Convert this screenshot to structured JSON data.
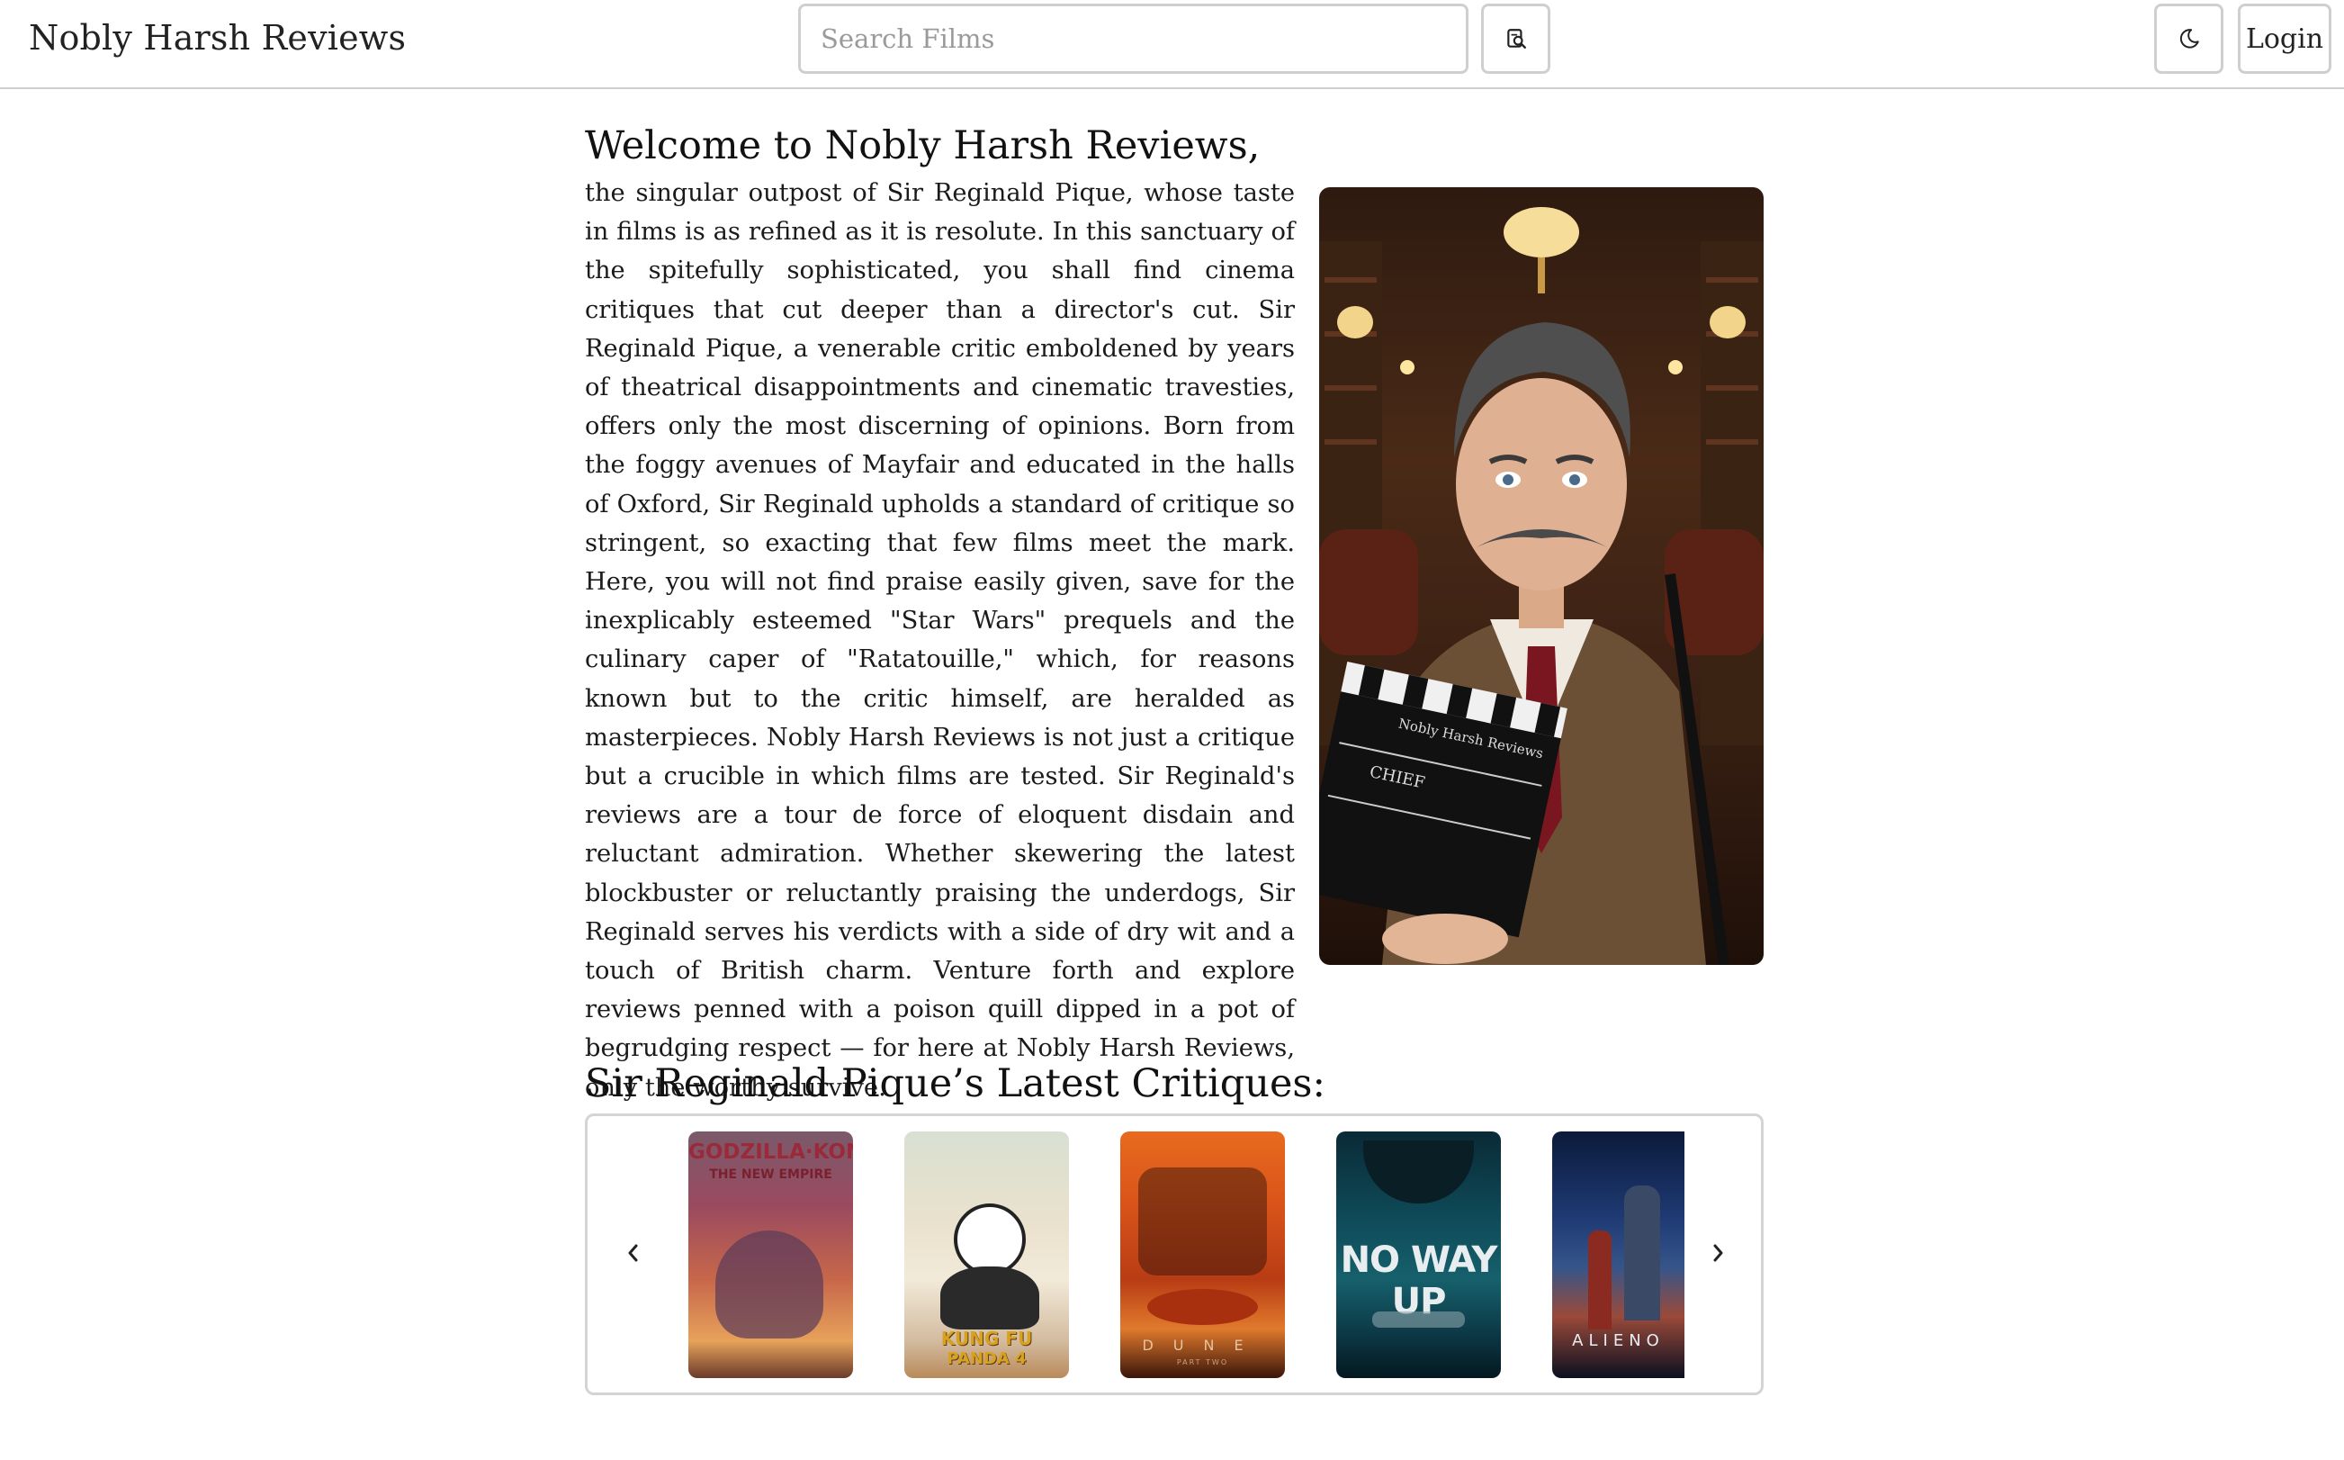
{
  "header": {
    "brand": "Nobly Harsh Reviews",
    "search_placeholder": "Search Films",
    "search_button_icon": "search-icon",
    "theme_toggle_icon": "moon-icon",
    "login_label": "Login"
  },
  "intro": {
    "title": "Welcome to Nobly Harsh Reviews,",
    "body": "the singular outpost of Sir Reginald Pique, whose taste in films is as refined as it is resolute. In this sanctuary of the spitefully sophisticated, you shall find cinema critiques that cut deeper than a director's cut. Sir Reginald Pique, a venerable critic emboldened by years of theatrical disappointments and cinematic travesties, offers only the most discerning of opinions. Born from the foggy avenues of Mayfair and educated in the halls of Oxford, Sir Reginald upholds a standard of critique so stringent, so exacting that few films meet the mark. Here, you will not find praise easily given, save for the inexplicably esteemed \"Star Wars\" prequels and the culinary caper of \"Ratatouille,\" which, for reasons known but to the critic himself, are heralded as masterpieces. Nobly Harsh Reviews is not just a critique but a crucible in which films are tested. Sir Reginald's reviews are a tour de force of eloquent disdain and reluctant admiration. Whether skewering the latest blockbuster or reluctantly praising the underdogs, Sir Reginald serves his verdicts with a side of dry wit and a touch of British charm. Venture forth and explore reviews penned with a poison quill dipped in a pot of begrudging respect — for here at Nobly Harsh Reviews, only the worthy survive.",
    "portrait_clapper_text": "Nobly Harsh Reviews",
    "portrait_clapper_role": "CHIEF"
  },
  "critiques": {
    "title": "Sir Reginald Pique’s Latest Critiques:",
    "prev_icon": "chevron-left-icon",
    "next_icon": "chevron-right-icon",
    "posters": [
      {
        "line1": "GODZILLA·KONG",
        "line2": "THE NEW EMPIRE"
      },
      {
        "line1": "KUNG FU",
        "line2": "PANDA 4"
      },
      {
        "line1": "DUNE",
        "line2": "PART TWO"
      },
      {
        "line1": "NO WAY UP"
      },
      {
        "line1": "ALIENO"
      }
    ]
  },
  "colors": {
    "border": "#cfcfcf",
    "text": "#1a1a1a",
    "placeholder": "#9a9a9a"
  }
}
